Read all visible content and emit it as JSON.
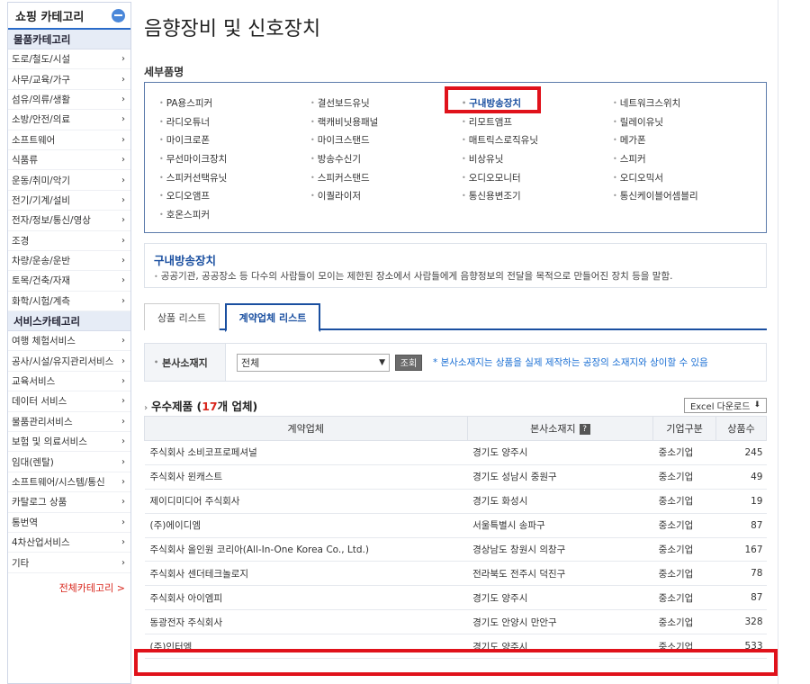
{
  "sidebar": {
    "title": "쇼핑 카테고리",
    "section1": "물품카테고리",
    "items1": [
      "도로/철도/시설",
      "사무/교육/가구",
      "섬유/의류/생활",
      "소방/안전/의료",
      "소프트웨어",
      "식품류",
      "운동/취미/악기",
      "전기/기계/설비",
      "전자/정보/통신/영상",
      "조경",
      "차량/운송/운반",
      "토목/건축/자재",
      "화학/시험/계측"
    ],
    "section2": "서비스카테고리",
    "items2": [
      "여행 체험서비스",
      "공사/시설/유지관리서비스",
      "교육서비스",
      "데이터 서비스",
      "물품관리서비스",
      "보험 및 의료서비스",
      "임대(렌탈)",
      "소프트웨어/시스템/통신",
      "카탈로그 상품",
      "통번역",
      "4차산업서비스",
      "기타"
    ],
    "all_link": "전체카테고리 >"
  },
  "main": {
    "title": "음향장비 및 신호장치",
    "detail_label": "세부품명",
    "detail_items": [
      "PA용스피커",
      "결선보드유닛",
      "구내방송장치",
      "네트워크스위치",
      "라디오튜너",
      "랙캐비닛용패널",
      "리모트앰프",
      "릴레이유닛",
      "마이크로폰",
      "마이크스탠드",
      "매트릭스로직유닛",
      "메가폰",
      "무선마이크장치",
      "방송수신기",
      "비상유닛",
      "스피커",
      "스피커선택유닛",
      "스피커스탠드",
      "오디오모니터",
      "오디오믹서",
      "오디오앰프",
      "이퀄라이저",
      "통신용변조기",
      "통신케이블어셈블리",
      "호온스피커"
    ],
    "selected_item": "구내방송장치",
    "desc_title": "구내방송장치",
    "desc_text": "공공기관, 공공장소 등 다수의 사람들이 모이는 제한된 장소에서 사람들에게 음향정보의 전달을 목적으로 만들어진 장치 등을 말함.",
    "tabs": [
      "상품 리스트",
      "계약업체 리스트"
    ],
    "filter": {
      "label": "본사소재지",
      "select_value": "전체",
      "button": "조회",
      "note": "* 본사소재지는 상품을 실제 제작하는 공장의 소재지와 상이할 수 있음"
    },
    "list": {
      "title_prefix": "우수제품 (",
      "count": "17",
      "title_suffix": "개 업체)",
      "excel": "Excel 다운로드",
      "columns": [
        "계약업체",
        "본사소재지",
        "기업구분",
        "상품수"
      ],
      "rows": [
        [
          "주식회사 소비코프로페셔널",
          "경기도 양주시",
          "중소기업",
          "245"
        ],
        [
          "주식회사 윈캐스트",
          "경기도 성남시 중원구",
          "중소기업",
          "49"
        ],
        [
          "제이디미디어 주식회사",
          "경기도 화성시",
          "중소기업",
          "19"
        ],
        [
          "(주)에이디엠",
          "서울특별시 송파구",
          "중소기업",
          "87"
        ],
        [
          "주식회사 올인원 코리아(All-In-One Korea Co., Ltd.)",
          "경상남도 창원시 의창구",
          "중소기업",
          "167"
        ],
        [
          "주식회사 센더테크놀로지",
          "전라북도 전주시 덕진구",
          "중소기업",
          "78"
        ],
        [
          "주식회사 아이엠피",
          "경기도 양주시",
          "중소기업",
          "87"
        ],
        [
          "동광전자 주식회사",
          "경기도 안양시 만안구",
          "중소기업",
          "328"
        ],
        [
          "(주)인터엠",
          "경기도 양주시",
          "중소기업",
          "533"
        ]
      ]
    }
  },
  "colors": {
    "accent": "#1a4fa0",
    "highlight": "#e0121b",
    "count": "#d8261c"
  }
}
